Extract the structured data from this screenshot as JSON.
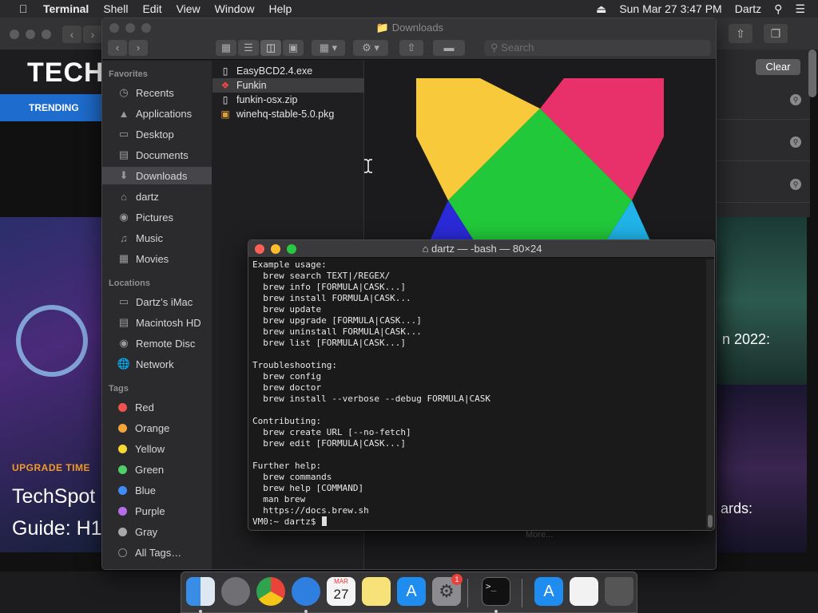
{
  "menubar": {
    "app": "Terminal",
    "items": [
      "Shell",
      "Edit",
      "View",
      "Window",
      "Help"
    ],
    "clock": "Sun Mar 27  3:47 PM",
    "user": "Dartz"
  },
  "browser": {
    "logo": "TECH",
    "trending": "TRENDING",
    "clear": "Clear",
    "section": "UPGRADE TIME",
    "headline_line1": "TechSpot",
    "headline_line2": "Guide: H1",
    "right_text1": "n 2022:",
    "right_text2": "ards:"
  },
  "finder": {
    "title": "Downloads",
    "search_placeholder": "Search",
    "favorites_header": "Favorites",
    "favorites": [
      {
        "label": "Recents",
        "icon": "clock-icon"
      },
      {
        "label": "Applications",
        "icon": "applications-icon"
      },
      {
        "label": "Desktop",
        "icon": "desktop-icon"
      },
      {
        "label": "Documents",
        "icon": "document-icon"
      },
      {
        "label": "Downloads",
        "icon": "downloads-icon"
      },
      {
        "label": "dartz",
        "icon": "home-icon"
      },
      {
        "label": "Pictures",
        "icon": "camera-icon"
      },
      {
        "label": "Music",
        "icon": "music-icon"
      },
      {
        "label": "Movies",
        "icon": "film-icon"
      }
    ],
    "locations_header": "Locations",
    "locations": [
      {
        "label": "Dartz’s iMac",
        "icon": "imac-icon"
      },
      {
        "label": "Macintosh HD",
        "icon": "hard-drive-icon"
      },
      {
        "label": "Remote Disc",
        "icon": "disc-icon"
      },
      {
        "label": "Network",
        "icon": "globe-icon"
      }
    ],
    "tags_header": "Tags",
    "tags": [
      {
        "label": "Red",
        "color": "#f0524f"
      },
      {
        "label": "Orange",
        "color": "#f6a436"
      },
      {
        "label": "Yellow",
        "color": "#f6d832"
      },
      {
        "label": "Green",
        "color": "#4fd16a"
      },
      {
        "label": "Blue",
        "color": "#3f8cf7"
      },
      {
        "label": "Purple",
        "color": "#b56ee8"
      },
      {
        "label": "Gray",
        "color": "#a8a8aa"
      },
      {
        "label": "All Tags…",
        "color": ""
      }
    ],
    "files": [
      {
        "name": "EasyBCD2.4.exe",
        "icon": "file-icon"
      },
      {
        "name": "Funkin",
        "icon": "app-icon"
      },
      {
        "name": "funkin-osx.zip",
        "icon": "zip-icon"
      },
      {
        "name": "winehq-stable-5.0.pkg",
        "icon": "package-icon"
      }
    ],
    "more": "More..."
  },
  "terminal": {
    "title": "dartz — -bash — 80×24",
    "lines": [
      "Example usage:",
      "  brew search TEXT|/REGEX/",
      "  brew info [FORMULA|CASK...]",
      "  brew install FORMULA|CASK...",
      "  brew update",
      "  brew upgrade [FORMULA|CASK...]",
      "  brew uninstall FORMULA|CASK...",
      "  brew list [FORMULA|CASK...]",
      "",
      "Troubleshooting:",
      "  brew config",
      "  brew doctor",
      "  brew install --verbose --debug FORMULA|CASK",
      "",
      "Contributing:",
      "  brew create URL [--no-fetch]",
      "  brew edit [FORMULA|CASK...]",
      "",
      "Further help:",
      "  brew commands",
      "  brew help [COMMAND]",
      "  man brew",
      "  https://docs.brew.sh"
    ],
    "prompt": "VM0:~ dartz$ "
  },
  "dock": {
    "calendar_month": "MAR",
    "calendar_day": "27",
    "badge": "1"
  }
}
